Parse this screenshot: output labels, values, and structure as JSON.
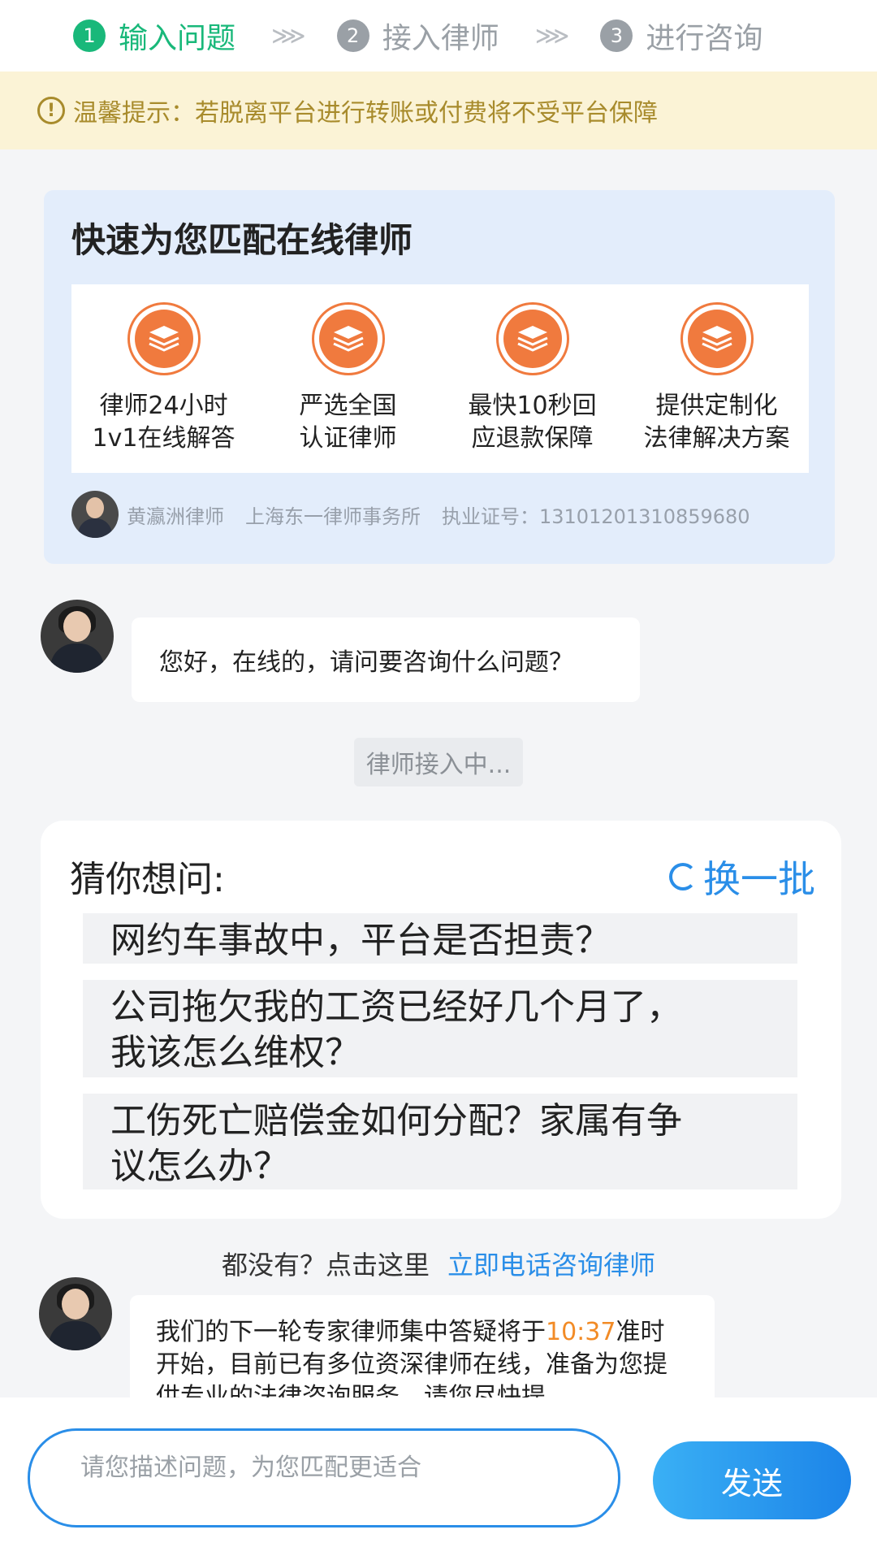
{
  "steps": [
    {
      "num": "1",
      "label": "输入问题"
    },
    {
      "num": "2",
      "label": "接入律师"
    },
    {
      "num": "3",
      "label": "进行咨询"
    }
  ],
  "step_arrow": "⋙",
  "notice": {
    "icon": "!",
    "text": "温馨提示：若脱离平台进行转账或付费将不受平台保障"
  },
  "match": {
    "title": "快速为您匹配在线律师",
    "features": [
      {
        "icon": "layers-icon",
        "text": "律师24小时\n1v1在线解答"
      },
      {
        "icon": "layers-icon",
        "text": "严选全国\n认证律师"
      },
      {
        "icon": "layers-icon",
        "text": "最快10秒回\n应退款保障"
      },
      {
        "icon": "layers-icon",
        "text": "提供定制化\n法律解决方案"
      }
    ],
    "lawyer_name": "黄瀛洲律师",
    "law_firm": "上海东一律师事务所",
    "license": "执业证号：13101201310859680"
  },
  "chat": {
    "greeting": "您好，在线的，请问要咨询什么问题？",
    "connecting": "律师接入中..."
  },
  "guess": {
    "title": "猜你想问:",
    "refresh_label": "换一批",
    "questions": [
      "网约车事故中，平台是否担责？",
      "公司拖欠我的工资已经好几个月了，\n我该怎么维权？",
      "工伤死亡赔偿金如何分配？家属有争\n议怎么办？"
    ]
  },
  "fallback": {
    "text": "都没有？点击这里",
    "link": "立即电话咨询律师"
  },
  "message2": {
    "before": "我们的下一轮专家律师集中答疑将于",
    "time": "10:37",
    "after": "准时开始，目前已有多位资深律师在线，准备为您提供专业的法律咨询服务，请您尽快提"
  },
  "input": {
    "placeholder": "请您描述问题，为您匹配更适合"
  },
  "send_label": "发送",
  "colors": {
    "accent_green": "#19b87a",
    "accent_blue": "#2a8ee8",
    "accent_orange": "#f07a3e"
  }
}
